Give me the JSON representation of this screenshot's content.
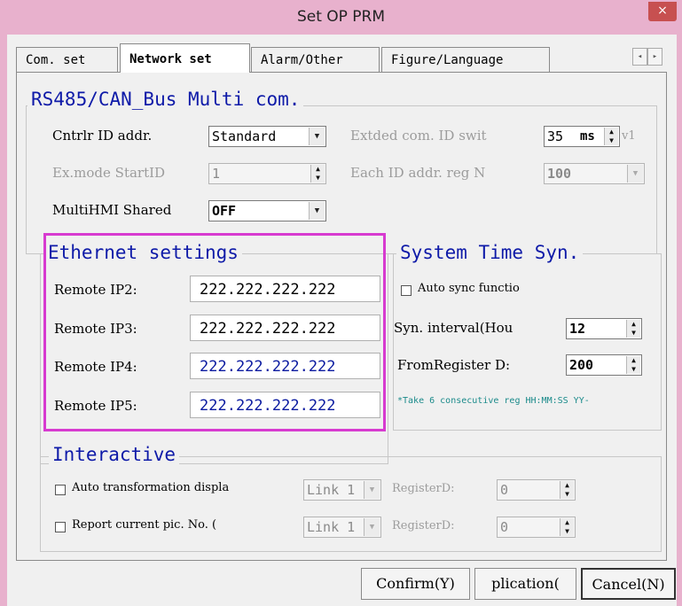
{
  "window": {
    "title": "Set OP PRM",
    "close_glyph": "×"
  },
  "tabs": [
    "Com. set",
    "Network set",
    "Alarm/Other",
    "Figure/Language"
  ],
  "tab_scroll": {
    "left": "◂",
    "right": "▸"
  },
  "rs485": {
    "title": "RS485/CAN_Bus Multi com.",
    "cntrlr_label": "Cntrlr ID addr.",
    "cntrlr_value": "Standard",
    "extded_label": "Extded com. ID swit",
    "extded_value": "35",
    "extded_unit": "ms",
    "extded_suffix": "v1",
    "exmode_label": "Ex.mode StartID",
    "exmode_value": "1",
    "each_label": "Each ID addr. reg N",
    "each_value": "100",
    "multihmi_label": "MultiHMI Shared",
    "multihmi_value": "OFF"
  },
  "ethernet": {
    "title": "Ethernet settings",
    "rows": [
      {
        "label": "Remote IP2:",
        "value": "222.222.222.222"
      },
      {
        "label": "Remote IP3:",
        "value": "222.222.222.222"
      },
      {
        "label": "Remote IP4:",
        "value": "222.222.222.222"
      },
      {
        "label": "Remote IP5:",
        "value": "222.222.222.222"
      }
    ]
  },
  "systime": {
    "title": "System Time Syn.",
    "auto_label": "Auto sync functio",
    "interval_label": "Syn. interval(Hou",
    "interval_value": "12",
    "from_label": "FromRegister D:",
    "from_value": "200",
    "note": "*Take 6 consecutive reg HH:MM:SS YY-"
  },
  "interactive": {
    "title": "Interactive",
    "row1_label": "Auto transformation displa",
    "row2_label": "Report current pic. No.   (",
    "link_value": "Link 1",
    "register_label": "RegisterD:",
    "register_value": "0"
  },
  "buttons": {
    "confirm": "Confirm(Y)",
    "application": "plication(",
    "cancel": "Cancel(N)"
  },
  "glyphs": {
    "down": "▼",
    "spin": "▲\n▼"
  }
}
